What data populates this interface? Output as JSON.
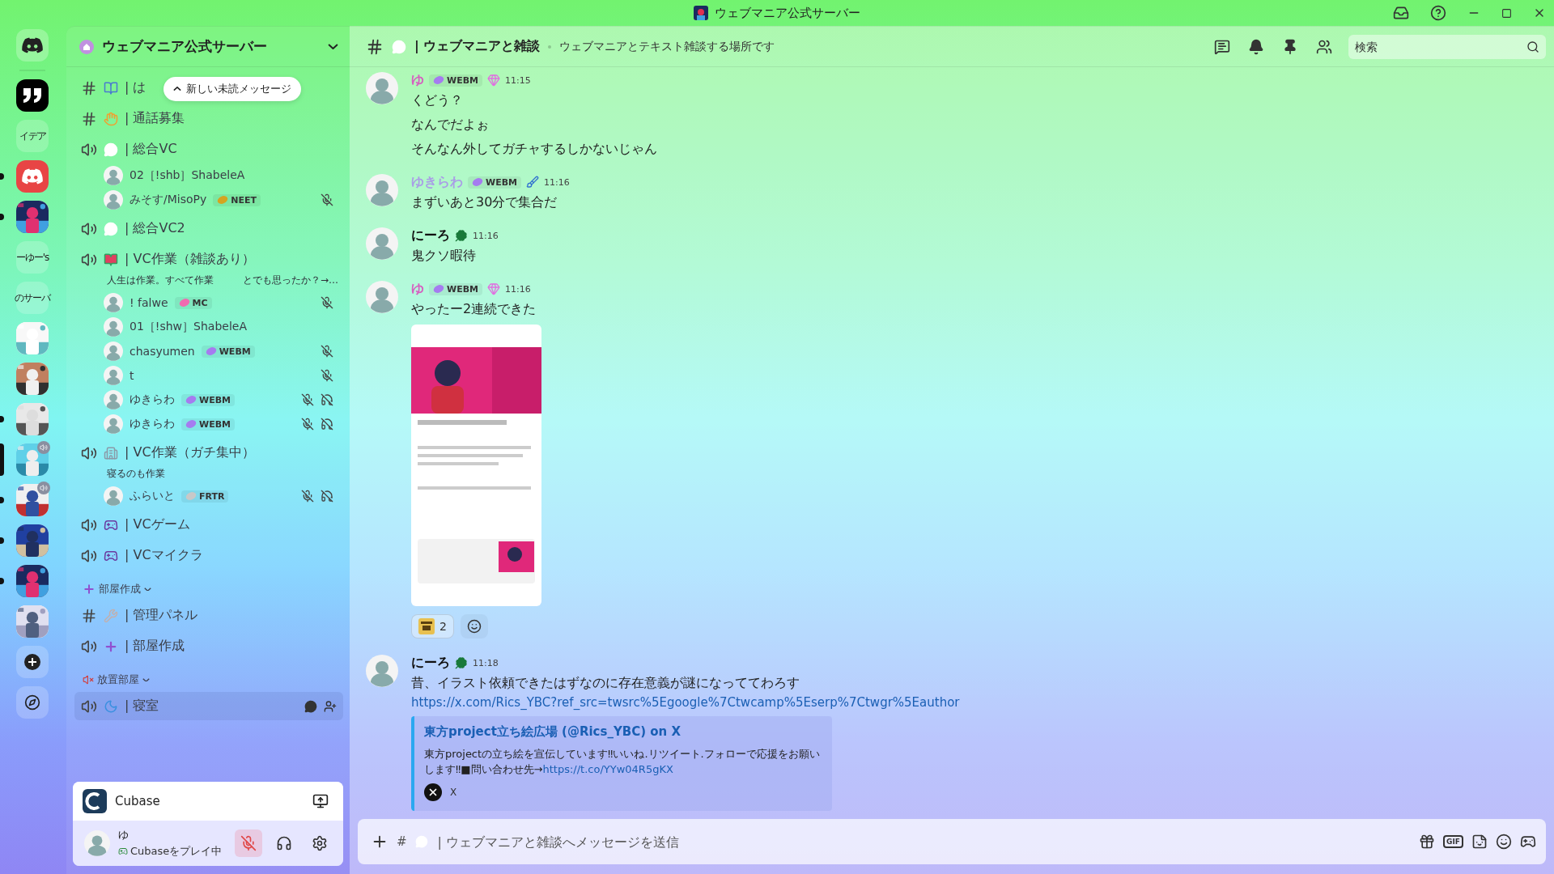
{
  "titlebar": {
    "title": "ウェブマニア公式サーバー"
  },
  "servers": [
    {
      "kind": "home",
      "selected": false,
      "unread": false,
      "voice": false
    },
    {
      "kind": "quote",
      "selected": false,
      "unread": false,
      "voice": false
    },
    {
      "kind": "text",
      "label": "イデア",
      "selected": false,
      "unread": false,
      "voice": false
    },
    {
      "kind": "discord",
      "selected": false,
      "unread": true,
      "voice": false
    },
    {
      "kind": "picture",
      "selected": false,
      "unread": true,
      "voice": false
    },
    {
      "kind": "text",
      "label": "ーゆー's",
      "selected": false,
      "unread": false,
      "voice": false
    },
    {
      "kind": "text",
      "label": "のサーバ",
      "selected": false,
      "unread": false,
      "voice": false
    },
    {
      "kind": "picture",
      "selected": false,
      "unread": false,
      "voice": false
    },
    {
      "kind": "picture",
      "selected": false,
      "unread": false,
      "voice": false
    },
    {
      "kind": "picture",
      "selected": false,
      "unread": true,
      "voice": false
    },
    {
      "kind": "picture",
      "selected": true,
      "unread": false,
      "voice": true
    },
    {
      "kind": "picture",
      "selected": false,
      "unread": true,
      "voice": true
    },
    {
      "kind": "picture",
      "selected": false,
      "unread": true,
      "voice": false
    },
    {
      "kind": "picture",
      "selected": false,
      "unread": true,
      "voice": false
    },
    {
      "kind": "picture",
      "selected": false,
      "unread": false,
      "voice": false
    },
    {
      "kind": "add",
      "selected": false,
      "unread": false,
      "voice": false
    },
    {
      "kind": "explore",
      "selected": false,
      "unread": false,
      "voice": false
    }
  ],
  "server_header": {
    "name": "ウェブマニア公式サーバー"
  },
  "unread_pill": {
    "label": "新しい未読メッセージ"
  },
  "channels": [
    {
      "kind": "text",
      "name": "| は",
      "selected": false
    },
    {
      "kind": "text",
      "name": "| 通話募集",
      "selected": false
    },
    {
      "kind": "voice",
      "name": "| 総合VC",
      "selected": false,
      "members": [
        {
          "name": "02［!shb］ShabeleA",
          "muted": false,
          "deafened": false
        },
        {
          "name": "みそす/MisoPy",
          "tag": {
            "label": "NEET",
            "color": "#d4a520"
          },
          "muted": true,
          "deafened": false
        }
      ]
    },
    {
      "kind": "voice",
      "name": "| 総合VC2",
      "selected": false
    },
    {
      "kind": "voice",
      "name": "| VC作業（雑談あり）",
      "status": "人生は作業。すべて作業　　　とでも思ったか？→…",
      "selected": false,
      "members": [
        {
          "name": "! falwe",
          "tag": {
            "label": "MC",
            "color": "#f06ab0"
          },
          "muted": true,
          "deafened": false
        },
        {
          "name": "01［!shw］ShabeleA",
          "muted": false,
          "deafened": false
        },
        {
          "name": "chasyumen",
          "tag": {
            "label": "WEBM",
            "color": "#a57cf0"
          },
          "muted": true,
          "deafened": false
        },
        {
          "name": "t",
          "muted": true,
          "deafened": false
        },
        {
          "name": "ゆきらわ",
          "tag": {
            "label": "WEBM",
            "color": "#a57cf0"
          },
          "muted": true,
          "deafened": true
        },
        {
          "name": "ゆきらわ",
          "tag": {
            "label": "WEBM",
            "color": "#a57cf0"
          },
          "muted": true,
          "deafened": true
        }
      ]
    },
    {
      "kind": "voice",
      "name": "| VC作業（ガチ集中）",
      "status": "寝るのも作業",
      "selected": false,
      "members": [
        {
          "name": "ふらいと",
          "tag": {
            "label": "FRTR",
            "color": "#c8c8c8"
          },
          "muted": true,
          "deafened": true
        }
      ]
    },
    {
      "kind": "voice",
      "name": "| VCゲーム",
      "selected": false
    },
    {
      "kind": "voice",
      "name": "| VCマイクラ",
      "selected": false
    }
  ],
  "categories": [
    {
      "name": "部屋作成",
      "expanded": true,
      "channels": [
        {
          "kind": "text",
          "name": "| 管理パネル",
          "selected": false
        },
        {
          "kind": "voice",
          "name": "| 部屋作成",
          "selected": false
        }
      ]
    },
    {
      "name": "放置部屋",
      "expanded": true,
      "channels": [
        {
          "kind": "voice",
          "name": "| 寝室",
          "selected": true
        }
      ]
    }
  ],
  "activity": {
    "name": "Cubase"
  },
  "user": {
    "name": "ゆ",
    "status": "Cubaseをプレイ中",
    "mic_muted": true,
    "deafened": false
  },
  "header": {
    "channel": "| ウェブマニアと雑談",
    "topic": "ウェブマニアとテキスト雑談する場所です",
    "search_placeholder": "検索"
  },
  "messages": [
    {
      "author": "ゆ",
      "color": "#d65fc0",
      "tag": {
        "label": "WEBM",
        "color": "#a57cf0"
      },
      "time": "11:15",
      "lines": [
        "くどう？",
        "なんでだよぉ",
        "そんなん外してガチャするしかないじゃん"
      ]
    },
    {
      "author": "ゆきらわ",
      "color": "#a99ee6",
      "tag": {
        "label": "WEBM",
        "color": "#a57cf0"
      },
      "time": "11:16",
      "lines": [
        "まずいあと30分で集合だ"
      ]
    },
    {
      "author": "にーろ",
      "color": "#111111",
      "time": "11:16",
      "lines": [
        "鬼クソ暇待"
      ]
    },
    {
      "author": "ゆ",
      "color": "#d65fc0",
      "tag": {
        "label": "WEBM",
        "color": "#a57cf0"
      },
      "time": "11:16",
      "lines": [
        "やったー2連続できた"
      ],
      "attachment": {
        "kind": "picture"
      },
      "reactions": [
        {
          "count": "2",
          "selected": false
        }
      ]
    },
    {
      "author": "にーろ",
      "color": "#111111",
      "time": "11:18",
      "lines": [
        "昔、イラスト依頼できたはずなのに存在意義が謎になっててわろす"
      ],
      "link": "https://x.com/Rics_YBC?ref_src=twsrc%5Egoogle%7Ctwcamp%5Eserp%7Ctwgr%5Eauthor",
      "embed": {
        "title": "東方project立ち絵広場 (@Rics_YBC) on X",
        "description": "東方projectの立ち絵を宣伝しています‼いいね.リツイート.フォローで応援をお願いします‼■問い合わせ先→",
        "description_link": "https://t.co/YYw04R5gKX",
        "provider": "X"
      }
    }
  ],
  "composer": {
    "prefix": "#",
    "placeholder": "| ウェブマニアと雑談へメッセージを送信",
    "gif_label": "GIF"
  }
}
